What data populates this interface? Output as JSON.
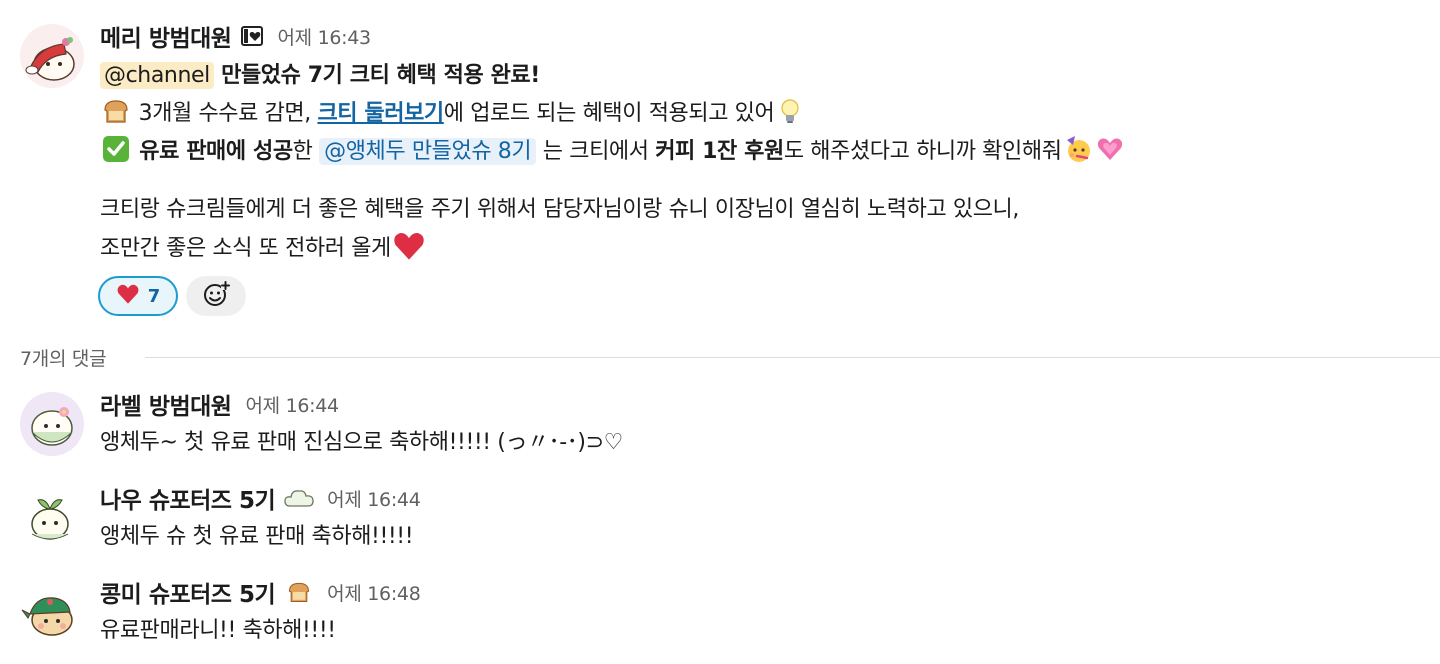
{
  "messages": [
    {
      "author": "메리 방범대원",
      "badge_icon": "black-heart-card-icon",
      "time": "어제 16:43",
      "avatar_icon": "santa-hat-character-avatar",
      "line1": {
        "mention": "@channel",
        "text": " 만들었슈 7기 크티 혜택 적용 완료!"
      },
      "line2": {
        "emoji": "bread-icon",
        "text_before": " 3개월 수수료 감면, ",
        "link": "크티 둘러보기",
        "text_after": "에 업로드 되는 혜택이 적용되고 있어",
        "emoji_end": "light-bulb-icon"
      },
      "line3": {
        "emoji": "check-mark-icon",
        "bold1": " 유료 판매에 성공",
        "text1": "한 ",
        "mention": "@앵체두 만들었슈 8기",
        "text2": " 는 크티에서 ",
        "bold2": "커피 1잔 후원",
        "text3": "도 해주셨다고 하니까 확인해줘",
        "emoji_end1": "partying-face-icon",
        "emoji_end2": "sparkling-heart-icon"
      },
      "para_line1": "크티랑 슈크림들에게 더 좋은 혜택을 주기 위해서 담당자님이랑 슈니 이장님이 열심히 노력하고 있으니,",
      "para_line2": "조만간 좋은 소식 또 전하러 올게",
      "para_emoji": "red-heart-icon",
      "reactions": [
        {
          "emoji": "red-heart-icon",
          "glyph": "❤️",
          "count": "7",
          "active": true
        }
      ],
      "add_reaction_icon": "add-reaction-icon"
    }
  ],
  "thread": {
    "divider_label": "7개의 댓글",
    "replies": [
      {
        "author": "라벨 방범대원",
        "time": "어제 16:44",
        "avatar_icon": "flower-character-avatar",
        "text": "앵체두~ 첫 유료 판매 진심으로 축하해!!!!! (っ〃･-･)⊃♡"
      },
      {
        "author": "나우 슈포터즈 5기",
        "badge_icon": "cloud-icon",
        "time": "어제 16:44",
        "avatar_icon": "sprout-character-avatar",
        "text": "앵체두 슈 첫 유료 판매 축하해!!!!!"
      },
      {
        "author": "콩미 슈포터즈 5기",
        "badge_icon": "bread-icon",
        "time": "어제 16:48",
        "avatar_icon": "cap-character-avatar",
        "text": "유료판매라니!! 축하해!!!!"
      }
    ]
  },
  "colors": {
    "link": "#1264a3",
    "channel_mention_bg": "#fcecc5",
    "user_mention_bg": "#e8f1fa",
    "reaction_active_bg": "#e8f5fa",
    "reaction_active_border": "#1d9bd1",
    "muted_text": "#616061"
  }
}
